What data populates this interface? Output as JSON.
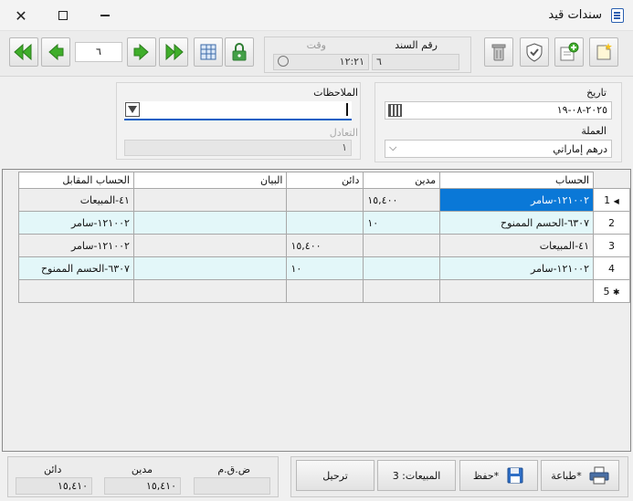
{
  "window": {
    "title": "سندات قيد"
  },
  "toolbar": {
    "record_number": "٦",
    "doc_no_label": "رقم السند",
    "doc_no_value": "٦",
    "time_label": "وقت",
    "time_value": "١٢:٢١"
  },
  "form": {
    "date_label": "تاريخ",
    "date_value": "٢٠٢٥-٠٨-١٩",
    "currency_label": "العملة",
    "currency_value": "درهم إماراتي",
    "notes_label": "الملاحظات",
    "notes_value": "",
    "rate_label": "التعادل",
    "rate_value": "١"
  },
  "grid": {
    "headers": {
      "account": "الحساب",
      "debit": "مدين",
      "credit": "دائن",
      "desc": "البيان",
      "counter": "الحساب المقابل"
    },
    "rows": [
      {
        "num": "1",
        "account": "١٢١٠٠٢-سامر",
        "debit": "١٥,٤٠٠",
        "credit": "",
        "desc": "",
        "counter": "٤١-المبيعات"
      },
      {
        "num": "2",
        "account": "٦٣٠٧-الحسم الممنوح",
        "debit": "١٠",
        "credit": "",
        "desc": "",
        "counter": "١٢١٠٠٢-سامر"
      },
      {
        "num": "3",
        "account": "٤١-المبيعات",
        "debit": "",
        "credit": "١٥,٤٠٠",
        "desc": "",
        "counter": "١٢١٠٠٢-سامر"
      },
      {
        "num": "4",
        "account": "١٢١٠٠٢-سامر",
        "debit": "",
        "credit": "١٠",
        "desc": "",
        "counter": "٦٣٠٧-الحسم الممنوح"
      },
      {
        "num": "5",
        "account": "",
        "debit": "",
        "credit": "",
        "desc": "",
        "counter": ""
      }
    ]
  },
  "footer": {
    "print_label": "طباعة*",
    "save_label": "حفظ*",
    "sales_label": "المبيعات: 3",
    "post_label": "ترحيل",
    "vat_label": "ض.ق.م",
    "vat_value": "",
    "debit_label": "مدين",
    "debit_total": "١٥,٤١٠",
    "credit_label": "دائن",
    "credit_total": "١٥,٤١٠"
  }
}
